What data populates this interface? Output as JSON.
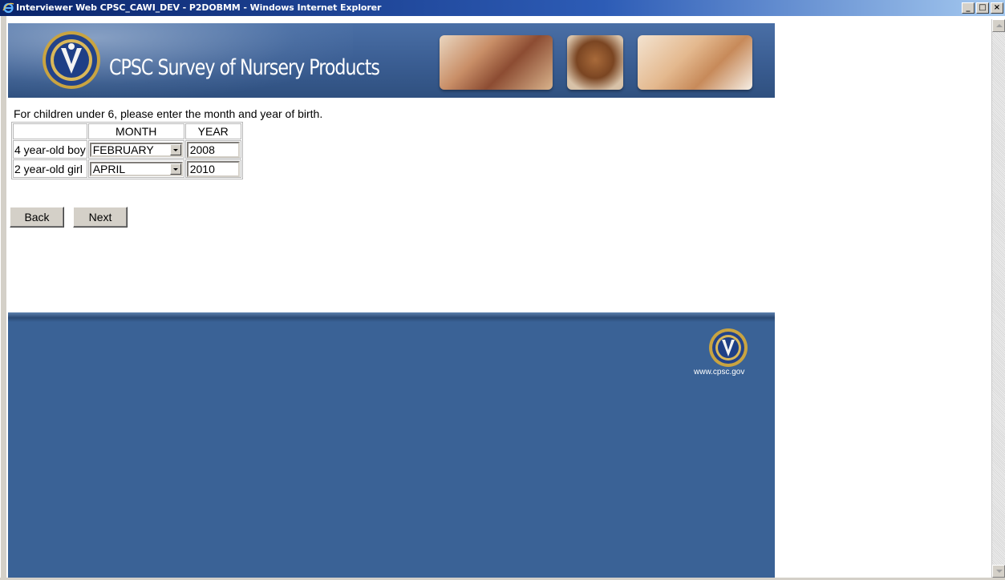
{
  "window": {
    "title": "Interviewer Web CPSC_CAWI_DEV - P2DOBMM - Windows Internet Explorer",
    "buttons": [
      "_",
      "□",
      "×"
    ]
  },
  "header": {
    "title": "CPSC Survey of Nursery Products"
  },
  "form": {
    "instructions": "For children under 6, please enter the month and year of birth.",
    "columns": [
      "",
      "MONTH",
      "YEAR"
    ],
    "rows": [
      {
        "label": "4 year-old boy",
        "month": "FEBRUARY",
        "year": "2008"
      },
      {
        "label": "2 year-old girl",
        "month": "APRIL",
        "year": "2010"
      }
    ]
  },
  "nav": {
    "back_label": "Back",
    "next_label": "Next"
  },
  "footer": {
    "url": "www.cpsc.gov"
  },
  "colors": {
    "banner": "#3a5d92",
    "footer": "#3a6296",
    "titlebar": "#0a246a"
  }
}
